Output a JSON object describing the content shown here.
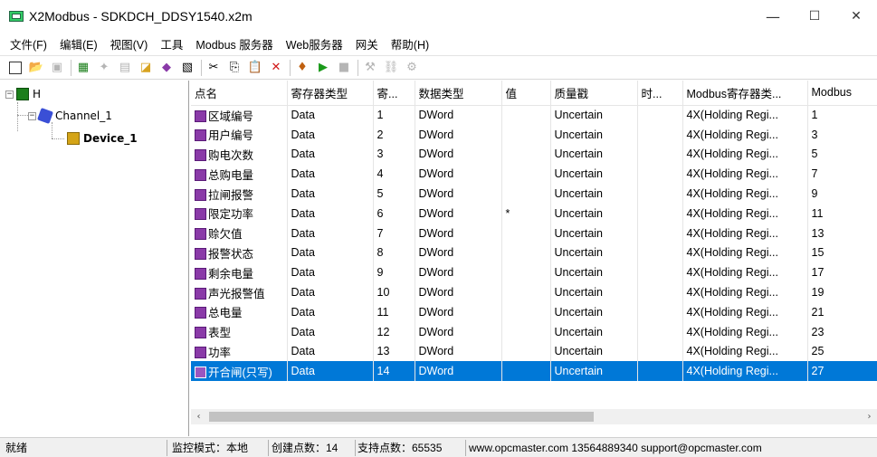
{
  "window": {
    "title": "X2Modbus - SDKDCH_DDSY1540.x2m",
    "minimize": "—",
    "maximize": "☐",
    "close": "✕"
  },
  "menu": [
    "文件(F)",
    "编辑(E)",
    "视图(V)",
    "工具",
    "Modbus 服务器",
    "Web服务器",
    "网关",
    "帮助(H)"
  ],
  "tree": {
    "root": "H",
    "channel": "Channel_1",
    "device": "Device_1"
  },
  "columns": [
    "点名",
    "寄存器类型",
    "寄...",
    "数据类型",
    "值",
    "质量戳",
    "时...",
    "Modbus寄存器类...",
    "Modbus"
  ],
  "rows": [
    [
      "区域编号",
      "Data",
      "1",
      "DWord",
      "",
      "Uncertain",
      "",
      "4X(Holding Regi...",
      "1"
    ],
    [
      "用户编号",
      "Data",
      "2",
      "DWord",
      "",
      "Uncertain",
      "",
      "4X(Holding Regi...",
      "3"
    ],
    [
      "购电次数",
      "Data",
      "3",
      "DWord",
      "",
      "Uncertain",
      "",
      "4X(Holding Regi...",
      "5"
    ],
    [
      "总购电量",
      "Data",
      "4",
      "DWord",
      "",
      "Uncertain",
      "",
      "4X(Holding Regi...",
      "7"
    ],
    [
      "拉闸报警",
      "Data",
      "5",
      "DWord",
      "",
      "Uncertain",
      "",
      "4X(Holding Regi...",
      "9"
    ],
    [
      "限定功率",
      "Data",
      "6",
      "DWord",
      "*",
      "Uncertain",
      "",
      "4X(Holding Regi...",
      "11"
    ],
    [
      "赊欠值",
      "Data",
      "7",
      "DWord",
      "",
      "Uncertain",
      "",
      "4X(Holding Regi...",
      "13"
    ],
    [
      "报警状态",
      "Data",
      "8",
      "DWord",
      "",
      "Uncertain",
      "",
      "4X(Holding Regi...",
      "15"
    ],
    [
      "剩余电量",
      "Data",
      "9",
      "DWord",
      "",
      "Uncertain",
      "",
      "4X(Holding Regi...",
      "17"
    ],
    [
      "声光报警值",
      "Data",
      "10",
      "DWord",
      "",
      "Uncertain",
      "",
      "4X(Holding Regi...",
      "19"
    ],
    [
      "总电量",
      "Data",
      "11",
      "DWord",
      "",
      "Uncertain",
      "",
      "4X(Holding Regi...",
      "21"
    ],
    [
      "表型",
      "Data",
      "12",
      "DWord",
      "",
      "Uncertain",
      "",
      "4X(Holding Regi...",
      "23"
    ],
    [
      "功率",
      "Data",
      "13",
      "DWord",
      "",
      "Uncertain",
      "",
      "4X(Holding Regi...",
      "25"
    ],
    [
      "开合闸(只写)",
      "Data",
      "14",
      "DWord",
      "",
      "Uncertain",
      "",
      "4X(Holding Regi...",
      "27"
    ]
  ],
  "selected_row": 13,
  "status": {
    "ready": "就绪",
    "mode": "监控模式：本地",
    "created": "创建点数：14",
    "supported": "支持点数：65535",
    "contact": "www.opcmaster.com 13564889340 support@opcmaster.com"
  }
}
